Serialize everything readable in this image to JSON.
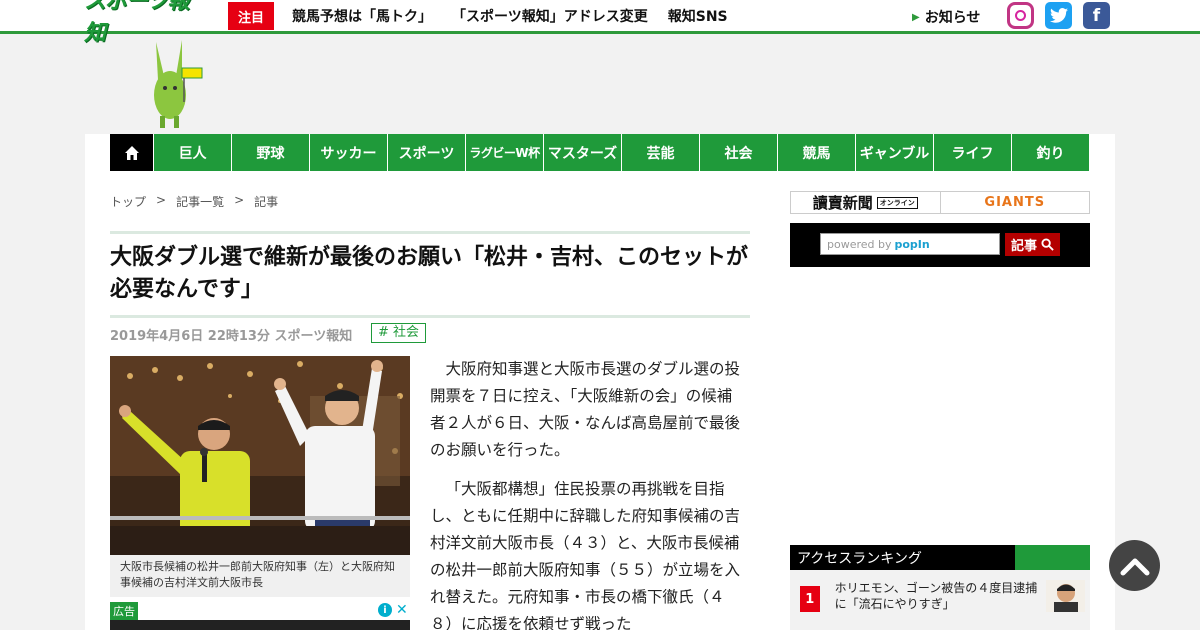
{
  "header": {
    "logo_text": "スポーツ報知",
    "chumoku_label": "注目",
    "links": [
      "競馬予想は「馬トク」",
      "「スポーツ報知」アドレス変更",
      "報知SNS"
    ],
    "news_label": "お知らせ"
  },
  "nav": {
    "items": [
      "巨人",
      "野球",
      "サッカー",
      "スポーツ",
      "ラグビーW杯",
      "マスターズ",
      "芸能",
      "社会",
      "競馬",
      "ギャンブル",
      "ライフ",
      "釣り"
    ]
  },
  "breadcrumb": [
    "トップ",
    "記事一覧",
    "記事"
  ],
  "breadcrumb_sep": ">",
  "article": {
    "headline": "大阪ダブル選で維新が最後のお願い「松井・吉村、このセットが必要なんです」",
    "meta": "2019年4月6日 22時13分  スポーツ報知",
    "tag": "# 社会",
    "caption": "大阪市長候補の松井一郎前大阪府知事（左）と大阪府知事候補の吉村洋文前大阪市長",
    "paragraphs": [
      "大阪府知事選と大阪市長選のダブル選の投開票を７日に控え、「大阪維新の会」の候補者２人が６日、大阪・なんば高島屋前で最後のお願いを行った。",
      "「大阪都構想」住民投票の再挑戦を目指し、ともに任期中に辞職した府知事候補の吉村洋文前大阪市長（４３）と、大阪市長候補の松井一郎前大阪府知事（５５）が立場を入れ替えた。元府知事・市長の橋下徹氏（４８）に応援を依頼せず戦った"
    ]
  },
  "ad": {
    "label": "広告"
  },
  "sidebar": {
    "yomiuri_label": "讀賣新聞",
    "yomiuri_badge": "オンライン",
    "giants_label": "GIANTS",
    "search_placeholder": "powered by",
    "search_brand": "popIn",
    "search_button": "記事",
    "ranking_title": "アクセスランキング",
    "ranking": [
      {
        "rank": "1",
        "title": "ホリエモン、ゴーン被告の４度目逮捕に「流石にやりすぎ」"
      }
    ]
  },
  "colors": {
    "brand_green": "#1f9a3a",
    "accent_red": "#e60012",
    "search_red": "#b30000"
  }
}
